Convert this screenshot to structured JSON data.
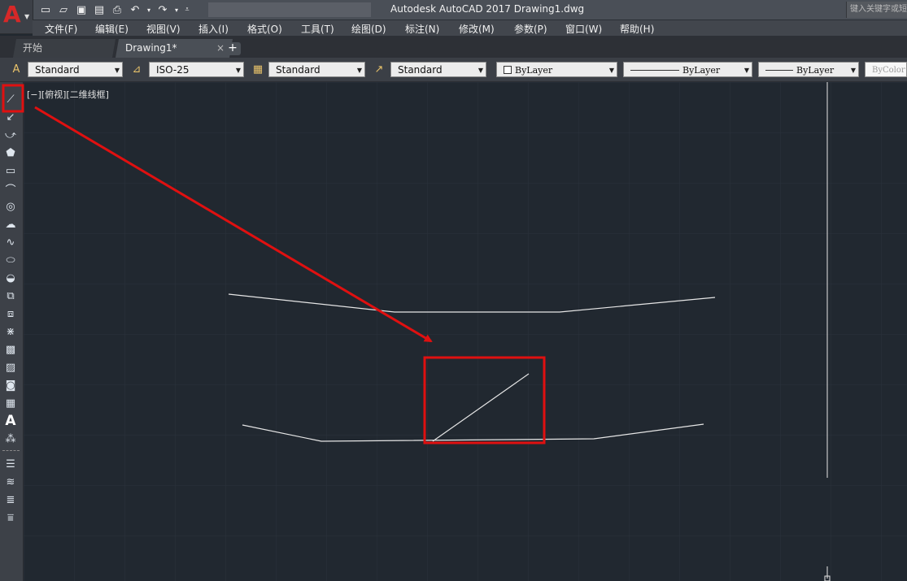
{
  "titlebar": {
    "app_logo": "A",
    "title": "Autodesk AutoCAD 2017    Drawing1.dwg",
    "search_placeholder": "键入关键字或短语",
    "qat_icons": [
      "new-file-icon",
      "open-folder-icon",
      "save-icon",
      "save-as-icon",
      "print-icon",
      "undo-icon",
      "undo-dropdown-icon",
      "redo-icon",
      "redo-dropdown-icon",
      "customize-icon"
    ]
  },
  "menu": {
    "items": [
      "文件(F)",
      "编辑(E)",
      "视图(V)",
      "插入(I)",
      "格式(O)",
      "工具(T)",
      "绘图(D)",
      "标注(N)",
      "修改(M)",
      "参数(P)",
      "窗口(W)",
      "帮助(H)"
    ]
  },
  "tabs": {
    "start": "开始",
    "drawing": "Drawing1*",
    "close_glyph": "×",
    "add_glyph": "+"
  },
  "properties_bar": {
    "text_style": "Standard",
    "dim_style": "ISO-25",
    "table_style": "Standard",
    "multileader_style": "Standard",
    "color": "ByLayer",
    "linetype": "ByLayer",
    "lineweight": "ByLayer",
    "plot_style": "ByColor"
  },
  "left_toolbar": {
    "tools": [
      "line-icon",
      "construction-line-icon",
      "polyline-icon",
      "polygon-icon",
      "rectangle-icon",
      "arc-icon",
      "circle-icon",
      "revision-cloud-icon",
      "spline-icon",
      "ellipse-icon",
      "ellipse-arc-icon",
      "insert-block-icon",
      "make-block-icon",
      "point-icon",
      "hatch-icon",
      "gradient-icon",
      "region-icon",
      "table-icon",
      "mtext-icon",
      "add-selected-icon",
      "layer-1-icon",
      "layer-2-icon",
      "layer-3-icon",
      "layer-4-icon"
    ],
    "text_tool_label": "A"
  },
  "viewport": {
    "label": "[−][俯视][二维线框]"
  },
  "colors": {
    "canvas": "#212830",
    "grid": "#2a323c",
    "annotation_red": "#e01010",
    "drawing_line": "#e6e6e6"
  }
}
